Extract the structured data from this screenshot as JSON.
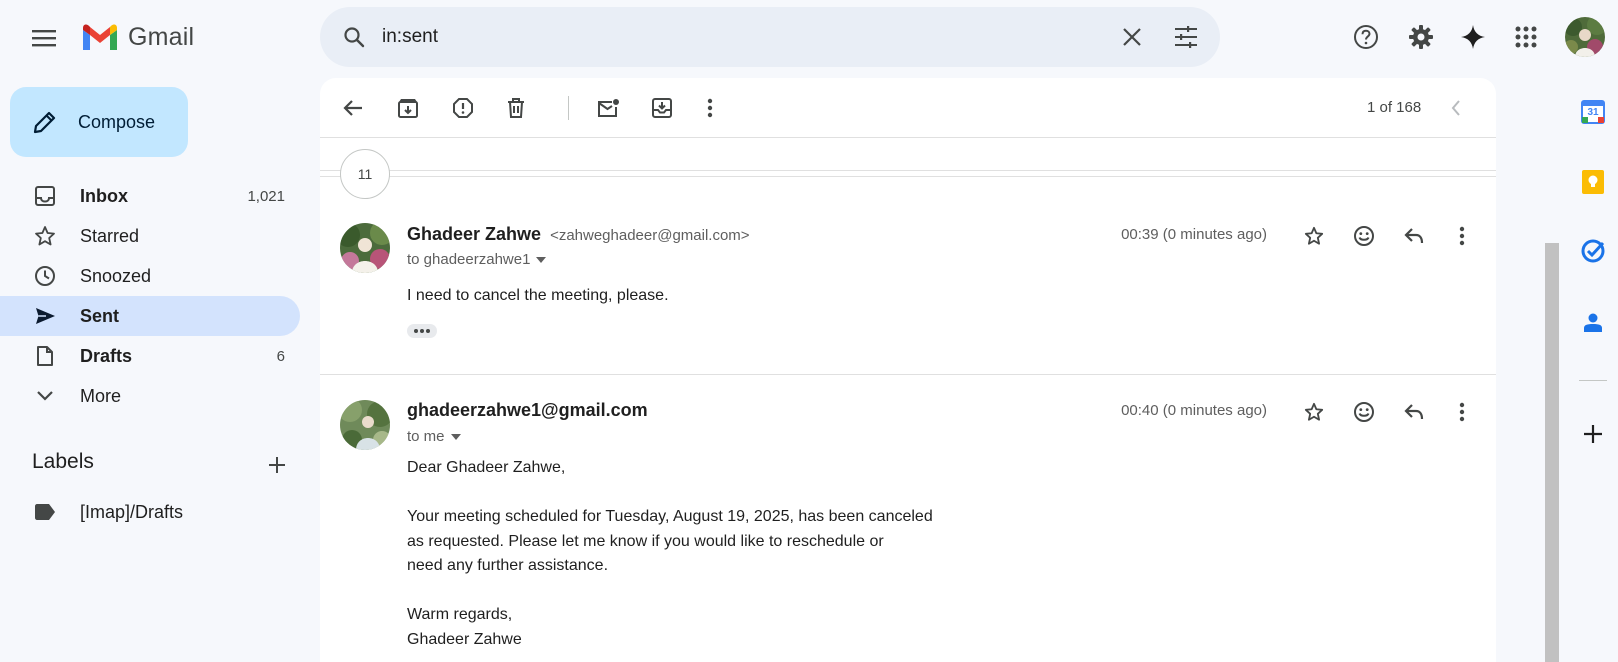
{
  "app": {
    "name": "Gmail"
  },
  "search": {
    "query": "in:sent"
  },
  "sidebar": {
    "compose_label": "Compose",
    "items": [
      {
        "label": "Inbox",
        "count": "1,021",
        "bold": true
      },
      {
        "label": "Starred",
        "count": ""
      },
      {
        "label": "Snoozed",
        "count": ""
      },
      {
        "label": "Sent",
        "count": "",
        "active": true,
        "bold": true
      },
      {
        "label": "Drafts",
        "count": "6",
        "bold": true
      },
      {
        "label": "More",
        "count": ""
      }
    ],
    "labels_heading": "Labels",
    "labels": [
      {
        "label": "[Imap]/Drafts"
      }
    ]
  },
  "toolbar": {
    "pager": "1 of 168"
  },
  "thread": {
    "collapsed_count": "11",
    "messages": [
      {
        "sender_name": "Ghadeer Zahwe",
        "sender_email": "<zahweghadeer@gmail.com>",
        "to": "to ghadeerzahwe1",
        "time": "00:39 (0 minutes ago)",
        "body": [
          "I need to cancel the meeting, please."
        ]
      },
      {
        "sender_name": "ghadeerzahwe1@gmail.com",
        "sender_email": "",
        "to": "to me",
        "time": "00:40 (0 minutes ago)",
        "body": [
          "Dear Ghadeer Zahwe,",
          "Your meeting scheduled for Tuesday, August 19, 2025, has been canceled",
          "as requested. Please let me know if you would like to reschedule or",
          "need any further assistance.",
          "Warm regards,",
          "Ghadeer Zahwe"
        ]
      }
    ]
  },
  "side_panel": {
    "calendar_day": "31"
  },
  "colors": {
    "background": "#f6f8fc",
    "compose_bg": "#c2e7ff",
    "active_nav_bg": "#d3e3fd",
    "search_bg": "#e9eef6",
    "gmail_red": "#ea4335",
    "gmail_blue": "#4285f4",
    "gmail_green": "#34a853",
    "gmail_yellow": "#fbbc04"
  },
  "icons": [
    "main-menu-icon",
    "gmail-logo-icon",
    "search-icon",
    "clear-search-icon",
    "search-options-icon",
    "help-icon",
    "settings-icon",
    "gemini-icon",
    "apps-grid-icon",
    "pencil-icon",
    "inbox-icon",
    "star-icon",
    "clock-icon",
    "send-icon",
    "draft-file-icon",
    "chevron-down-icon",
    "add-icon",
    "label-icon",
    "back-arrow-icon",
    "archive-icon",
    "report-spam-icon",
    "delete-icon",
    "mark-unread-icon",
    "move-to-icon",
    "more-vert-icon",
    "chevron-left-icon",
    "chevron-right-icon",
    "emoji-icon",
    "reply-icon",
    "ellipsis-icon",
    "calendar-icon",
    "keep-icon",
    "tasks-icon",
    "contacts-icon"
  ]
}
